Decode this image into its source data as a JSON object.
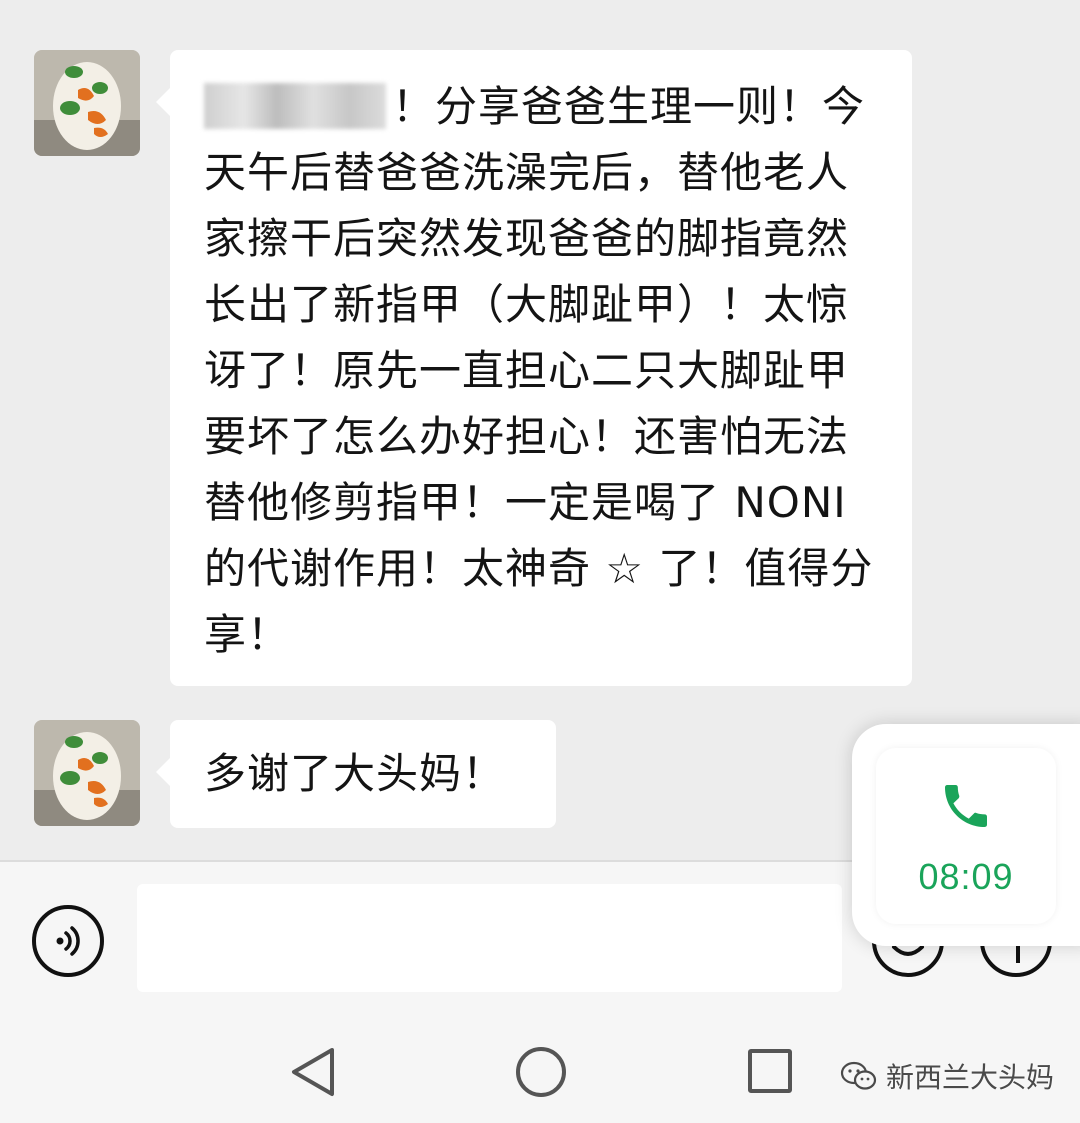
{
  "messages": [
    {
      "text": "！分享爸爸生理一则！今天午后替爸爸洗澡完后，替他老人家擦干后突然发现爸爸的脚指竟然长出了新指甲（大脚趾甲）！太惊讶了！原先一直担心二只大脚趾甲要坏了怎么办好担心！还害怕无法替他修剪指甲！一定是喝了 NONI 的代谢作用！太神奇 ☆ 了！值得分享！"
    },
    {
      "text": "多谢了大头妈！"
    }
  ],
  "call": {
    "duration": "08:09"
  },
  "watermark": {
    "text": "新西兰大头妈"
  },
  "icons": {
    "voice": "voice-icon",
    "emoji": "emoji-icon",
    "plus": "plus-icon",
    "phone": "phone-icon",
    "back": "nav-back-icon",
    "home": "nav-home-icon",
    "recent": "nav-recent-icon",
    "wechat": "wechat-logo-icon"
  },
  "colors": {
    "call_green": "#1aa45a",
    "chat_bg": "#ededed",
    "bubble_bg": "#ffffff"
  }
}
